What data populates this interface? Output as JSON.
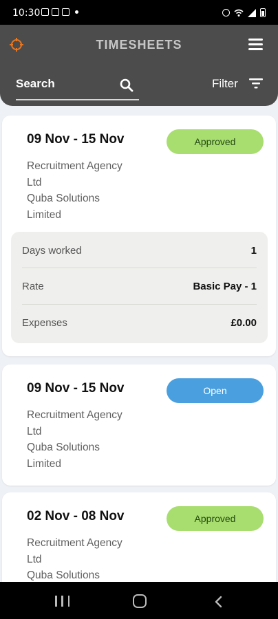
{
  "status_bar": {
    "time": "10:30"
  },
  "header": {
    "title": "TIMESHEETS",
    "search_label": "Search",
    "filter_label": "Filter"
  },
  "timesheets": [
    {
      "date_range": "09 Nov - 15 Nov",
      "status": "Approved",
      "agency_line1": "Recruitment Agency",
      "agency_line2": "Ltd",
      "company_line1": "Quba Solutions",
      "company_line2": "Limited",
      "details": [
        {
          "label": "Days worked",
          "value": "1"
        },
        {
          "label": "Rate",
          "value": "Basic Pay - 1"
        },
        {
          "label": "Expenses",
          "value": "£0.00"
        }
      ]
    },
    {
      "date_range": "09 Nov - 15 Nov",
      "status": "Open",
      "agency_line1": "Recruitment Agency",
      "agency_line2": "Ltd",
      "company_line1": "Quba Solutions",
      "company_line2": "Limited"
    },
    {
      "date_range": "02 Nov - 08 Nov",
      "status": "Approved",
      "agency_line1": "Recruitment Agency",
      "agency_line2": "Ltd",
      "company_line1": "Quba Solutions"
    }
  ],
  "colors": {
    "header_bg": "#4c4c4c",
    "accent_orange": "#e87722",
    "approved_badge": "#a8dd6f",
    "open_badge": "#4a9fdf"
  }
}
